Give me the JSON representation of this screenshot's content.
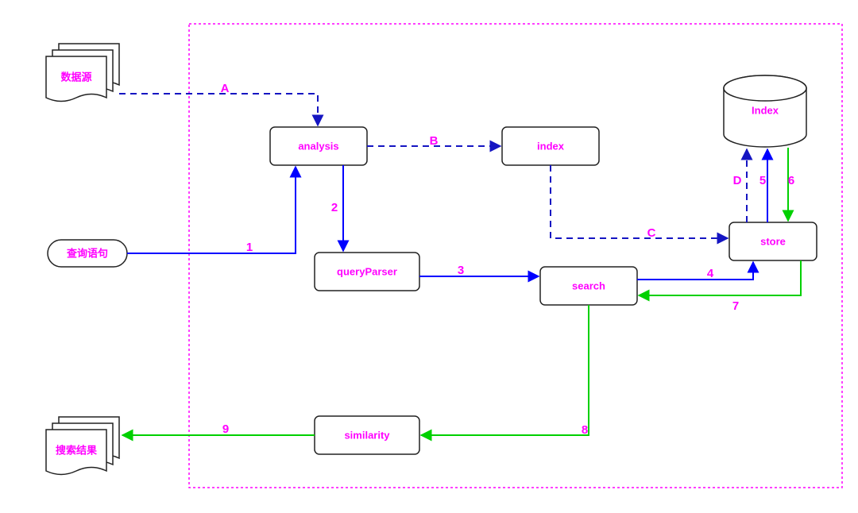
{
  "external": {
    "data_source": "数据源",
    "query_stmt": "查询语句",
    "results": "搜索结果"
  },
  "nodes": {
    "analysis": "analysis",
    "index": "index",
    "query_parser": "queryParser",
    "search": "search",
    "store": "store",
    "similarity": "similarity",
    "index_db": "Index"
  },
  "edges": {
    "A": "A",
    "B": "B",
    "C": "C",
    "D": "D",
    "1": "1",
    "2": "2",
    "3": "3",
    "4": "4",
    "5": "5",
    "6": "6",
    "7": "7",
    "8": "8",
    "9": "9"
  },
  "colors": {
    "magenta": "#ff00ff",
    "blue_solid": "#0000ff",
    "blue_dashed": "#1515c2",
    "green": "#00d000",
    "box_border": "#222222",
    "container_border": "#ff00ff"
  }
}
